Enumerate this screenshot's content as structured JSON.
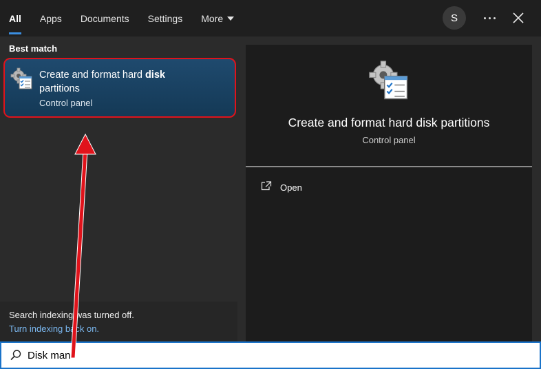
{
  "tabs": [
    {
      "label": "All",
      "active": true
    },
    {
      "label": "Apps"
    },
    {
      "label": "Documents"
    },
    {
      "label": "Settings"
    },
    {
      "label": "More",
      "has_dropdown": true
    }
  ],
  "header": {
    "avatar_letter": "S",
    "more_options_icon": "ellipsis-icon",
    "close_icon": "close-icon"
  },
  "results": {
    "section_label": "Best match",
    "best_match": {
      "title_prefix": "Create and format hard ",
      "title_bold": "disk",
      "title_suffix": "partitions",
      "subtitle": "Control panel",
      "icon": "control-panel-tools-icon",
      "highlight_color": "#e0131b"
    }
  },
  "indexing": {
    "message": "Search indexing was turned off.",
    "link": "Turn indexing back on."
  },
  "preview": {
    "title": "Create and format hard disk partitions",
    "subtitle": "Control panel",
    "icon": "control-panel-tools-icon",
    "actions": [
      {
        "label": "Open",
        "icon": "open-external-icon"
      }
    ]
  },
  "search": {
    "value": "Disk man",
    "icon": "search-icon"
  },
  "colors": {
    "accent": "#3b8ee0",
    "annotation": "#e0131b",
    "selected_bg": "#1f4a6e"
  }
}
